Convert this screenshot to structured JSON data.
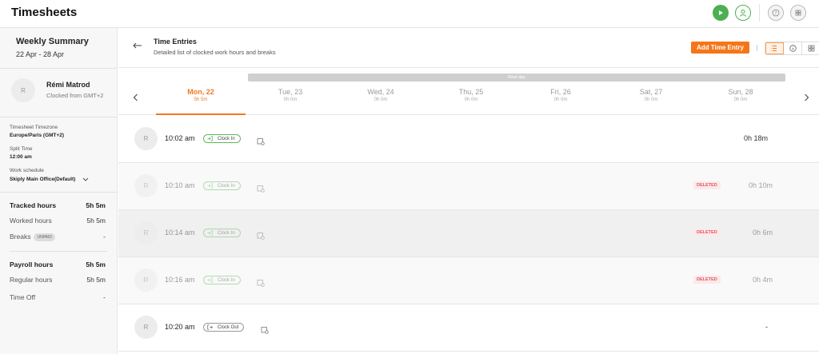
{
  "app": {
    "title": "Timesheets"
  },
  "sidebar": {
    "summary_title": "Weekly Summary",
    "date_range": "22 Apr - 28 Apr",
    "user": {
      "avatar_initial": "R",
      "name": "Rémi Matrod",
      "clocked_from": "Clocked from GMT+2"
    },
    "timezone_label": "Timesheet Timezone",
    "timezone_value": "Europe/Paris (GMT+2)",
    "split_label": "Split Time",
    "split_value": "12:00 am",
    "schedule_label": "Work schedule",
    "schedule_value": "Skiply Main Office(Default)",
    "hours": [
      {
        "label": "Tracked hours",
        "value": "5h 5m"
      },
      {
        "label": "Worked hours",
        "value": "5h 5m"
      },
      {
        "label": "Breaks",
        "badge": "UNPAID",
        "value": "-"
      }
    ],
    "payroll": [
      {
        "label": "Payroll hours",
        "value": "5h 5m"
      },
      {
        "label": "Regular hours",
        "value": "5h 5m"
      },
      {
        "label": "Time Off",
        "value": "-"
      }
    ]
  },
  "header": {
    "title": "Time Entries",
    "subtitle": "Detailed list of clocked work hours and breaks",
    "add_button": "Add Time Entry"
  },
  "week": {
    "rest_day_label": "Rest day",
    "days": [
      {
        "name": "Mon, 22",
        "hours": "5h 5m"
      },
      {
        "name": "Tue, 23",
        "hours": "0h 0m"
      },
      {
        "name": "Wed, 24",
        "hours": "0h 0m"
      },
      {
        "name": "Thu, 25",
        "hours": "0h 0m"
      },
      {
        "name": "Fri, 26",
        "hours": "0h 0m"
      },
      {
        "name": "Sat, 27",
        "hours": "0h 0m"
      },
      {
        "name": "Sun, 28",
        "hours": "0h 0m"
      }
    ]
  },
  "entries": [
    {
      "avatar": "R",
      "time": "10:02 am",
      "type": "Clock In",
      "status": "",
      "duration": "0h 18m"
    },
    {
      "avatar": "R",
      "time": "10:10 am",
      "type": "Clock In",
      "status": "DELETED",
      "duration": "0h 10m"
    },
    {
      "avatar": "R",
      "time": "10:14 am",
      "type": "Clock In",
      "status": "DELETED",
      "duration": "0h 6m"
    },
    {
      "avatar": "R",
      "time": "10:16 am",
      "type": "Clock In",
      "status": "DELETED",
      "duration": "0h 4m"
    },
    {
      "avatar": "R",
      "time": "10:20 am",
      "type": "Clock Out",
      "status": "",
      "duration": "-"
    }
  ],
  "colors": {
    "accent": "#f5761a",
    "success": "#4caf50",
    "danger": "#e0585d"
  },
  "icons": [
    "play-icon",
    "user-check-icon",
    "help-icon",
    "apps-icon",
    "back-arrow-icon",
    "list-view-icon",
    "info-view-icon",
    "grid-view-icon",
    "chevron-left-icon",
    "chevron-right-icon",
    "clock-in-icon",
    "clock-out-icon",
    "note-icon",
    "chevron-down-icon"
  ]
}
